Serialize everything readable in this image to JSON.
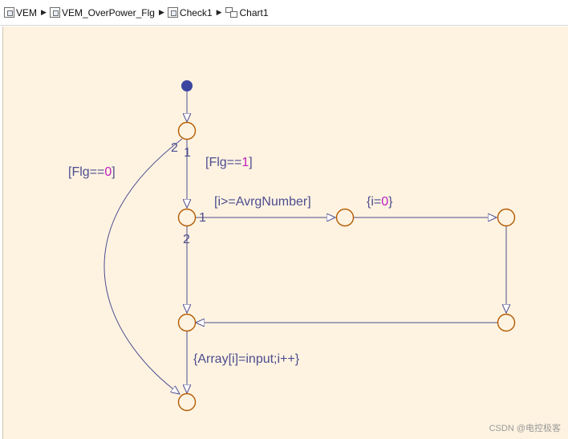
{
  "breadcrumb": {
    "items": [
      {
        "label": "VEM",
        "icon": "subsystem-icon"
      },
      {
        "label": "VEM_OverPower_Flg",
        "icon": "subsystem-icon"
      },
      {
        "label": "Check1",
        "icon": "subsystem-icon"
      },
      {
        "label": "Chart1",
        "icon": "chart-icon"
      }
    ]
  },
  "diagram": {
    "labels": {
      "cond_flg0_a": "[Flg==",
      "cond_flg0_b": "0",
      "cond_flg0_c": "]",
      "cond_flg1_a": "[Flg==",
      "cond_flg1_b": "1",
      "cond_flg1_c": "]",
      "cond_avrg": "[i>=AvrgNumber]",
      "act_i0_a": "{i=",
      "act_i0_b": "0",
      "act_i0_c": "}",
      "act_array": "{Array[i]=input;i++}"
    },
    "priorities": {
      "j1_left": "2",
      "j1_down": "1",
      "j2_right": "1",
      "j2_down": "2"
    }
  },
  "watermark": "CSDN @电控极客",
  "colors": {
    "canvas": "#fef3e1",
    "junction": "#b35a00",
    "default_transition_dot": "#3a46a0",
    "transition": "#4d4d8f",
    "numeric_literal": "#c020c0"
  }
}
